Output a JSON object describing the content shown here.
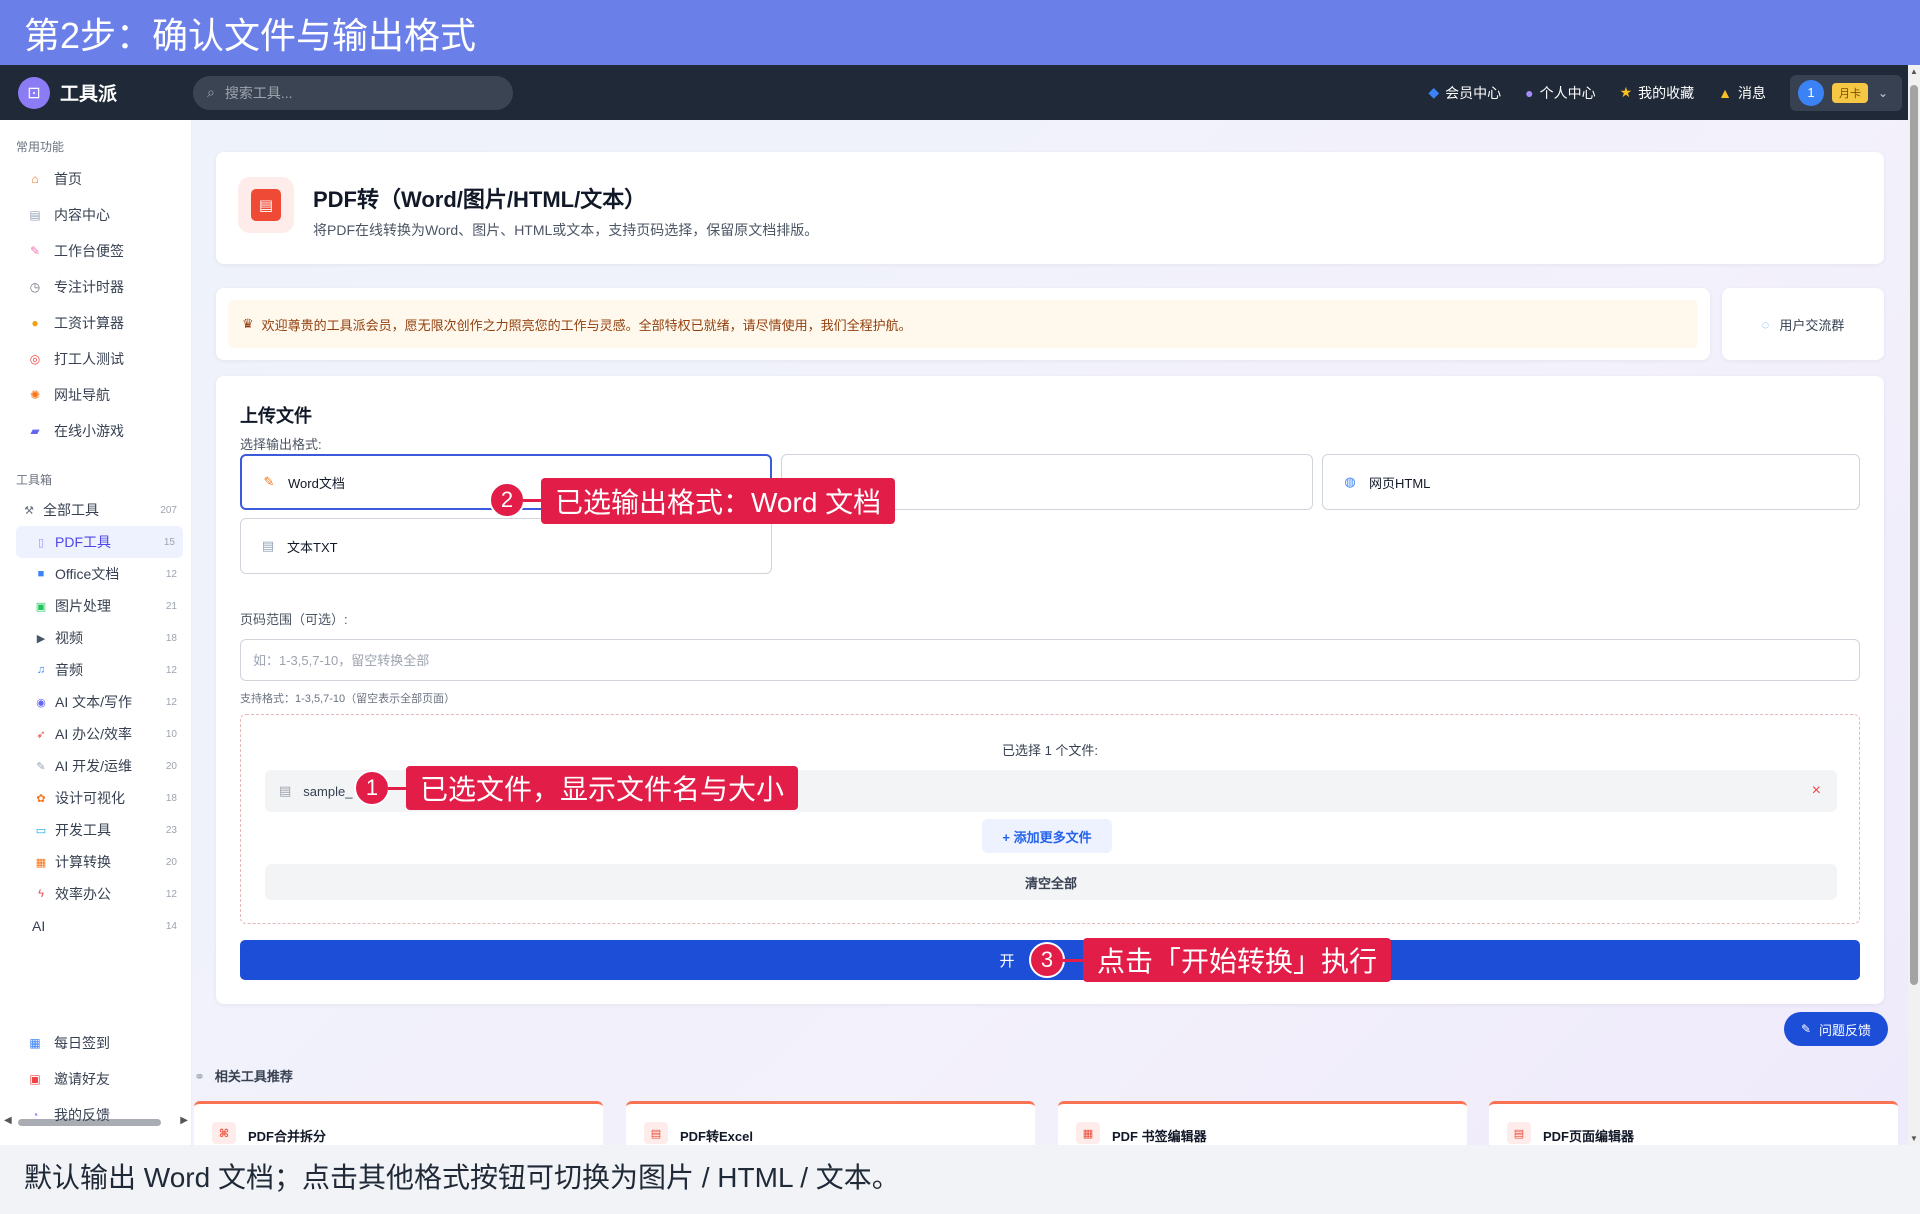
{
  "step_title": "第2步：确认文件与输出格式",
  "caption": "默认输出 Word 文档；点击其他格式按钮可切换为图片 / HTML / 文本。",
  "nav": {
    "brand": "工具派",
    "search_placeholder": "搜索工具...",
    "links": [
      {
        "icon": "diamond-icon",
        "label": "会员中心"
      },
      {
        "icon": "user-icon",
        "label": "个人中心"
      },
      {
        "icon": "star-icon",
        "label": "我的收藏"
      },
      {
        "icon": "bell-icon",
        "label": "消息"
      }
    ],
    "user_avatar": "1",
    "user_tier": "月卡"
  },
  "sidebar": {
    "common_label": "常用功能",
    "common": [
      {
        "icon": "home-icon",
        "label": "首页"
      },
      {
        "icon": "document-icon",
        "label": "内容中心"
      },
      {
        "icon": "note-icon",
        "label": "工作台便签"
      },
      {
        "icon": "stopwatch-icon",
        "label": "专注计时器"
      },
      {
        "icon": "money-bag-icon",
        "label": "工资计算器"
      },
      {
        "icon": "target-icon",
        "label": "打工人测试"
      },
      {
        "icon": "compass-icon",
        "label": "网址导航"
      },
      {
        "icon": "gamepad-icon",
        "label": "在线小游戏"
      }
    ],
    "tools_label": "工具箱",
    "tools": [
      {
        "icon": "tools-icon",
        "label": "全部工具",
        "count": "207"
      },
      {
        "icon": "pdf-icon",
        "label": "PDF工具",
        "count": "15",
        "active": true
      },
      {
        "icon": "office-icon",
        "label": "Office文档",
        "count": "12"
      },
      {
        "icon": "image-icon",
        "label": "图片处理",
        "count": "21"
      },
      {
        "icon": "video-icon",
        "label": "视频",
        "count": "18"
      },
      {
        "icon": "music-icon",
        "label": "音频",
        "count": "12"
      },
      {
        "icon": "robot-icon",
        "label": "AI 文本/写作",
        "count": "12"
      },
      {
        "icon": "rocket-icon",
        "label": "AI 办公/效率",
        "count": "10"
      },
      {
        "icon": "wrench-icon",
        "label": "AI 开发/运维",
        "count": "20"
      },
      {
        "icon": "palette-icon",
        "label": "设计可视化",
        "count": "18"
      },
      {
        "icon": "monitor-icon",
        "label": "开发工具",
        "count": "23"
      },
      {
        "icon": "calculator-icon",
        "label": "计算转换",
        "count": "20"
      },
      {
        "icon": "lightning-icon",
        "label": "效率办公",
        "count": "12"
      },
      {
        "icon": "",
        "label": "AI",
        "count": "14"
      }
    ],
    "bottom": [
      {
        "icon": "calendar-icon",
        "label": "每日签到"
      },
      {
        "icon": "gift-icon",
        "label": "邀请好友"
      },
      {
        "icon": "chat-icon",
        "label": "我的反馈"
      }
    ]
  },
  "tool_header": {
    "title": "PDF转（Word/图片/HTML/文本）",
    "description": "将PDF在线转换为Word、图片、HTML或文本，支持页码选择，保留原文档排版。"
  },
  "welcome_text": "欢迎尊贵的工具派会员，愿无限次创作之力照亮您的工作与灵感。全部特权已就绪，请尽情使用，我们全程护航。",
  "group_label": "用户交流群",
  "upload": {
    "heading": "上传文件",
    "format_label": "选择输出格式:",
    "formats": [
      {
        "icon": "word-doc-icon",
        "label": "Word文档",
        "selected": true
      },
      {
        "icon": "",
        "label": "",
        "selected": false
      },
      {
        "icon": "globe-icon",
        "label": "网页HTML",
        "selected": false
      },
      {
        "icon": "text-file-icon",
        "label": "文本TXT",
        "selected": false
      }
    ],
    "range_label": "页码范围（可选）:",
    "range_placeholder": "如：1-3,5,7-10，留空转换全部",
    "range_value": "",
    "range_hint": "支持格式：1-3,5,7-10（留空表示全部页面）",
    "selected_count": "已选择 1 个文件:",
    "file_name": "sample_",
    "remove": "×",
    "add_more": "+ 添加更多文件",
    "clear_all": "清空全部",
    "start_visible": "开"
  },
  "related": {
    "label": "相关工具推荐",
    "items": [
      {
        "icon": "merge-icon",
        "label": "PDF合并拆分"
      },
      {
        "icon": "excel-icon",
        "label": "PDF转Excel"
      },
      {
        "icon": "bookmark-icon",
        "label": "PDF 书签编辑器"
      },
      {
        "icon": "page-icon",
        "label": "PDF页面编辑器"
      }
    ]
  },
  "feedback_button": "问题反馈",
  "callouts": [
    {
      "num": "1",
      "text": "已选文件，显示文件名与大小"
    },
    {
      "num": "2",
      "text": "已选输出格式：Word 文档"
    },
    {
      "num": "3",
      "text": "点击「开始转换」执行"
    }
  ],
  "colors": {
    "accent": "#1d4ed8",
    "callout": "#e11d48",
    "step_bar": "#6b7fe8",
    "nav": "#1f2937"
  }
}
